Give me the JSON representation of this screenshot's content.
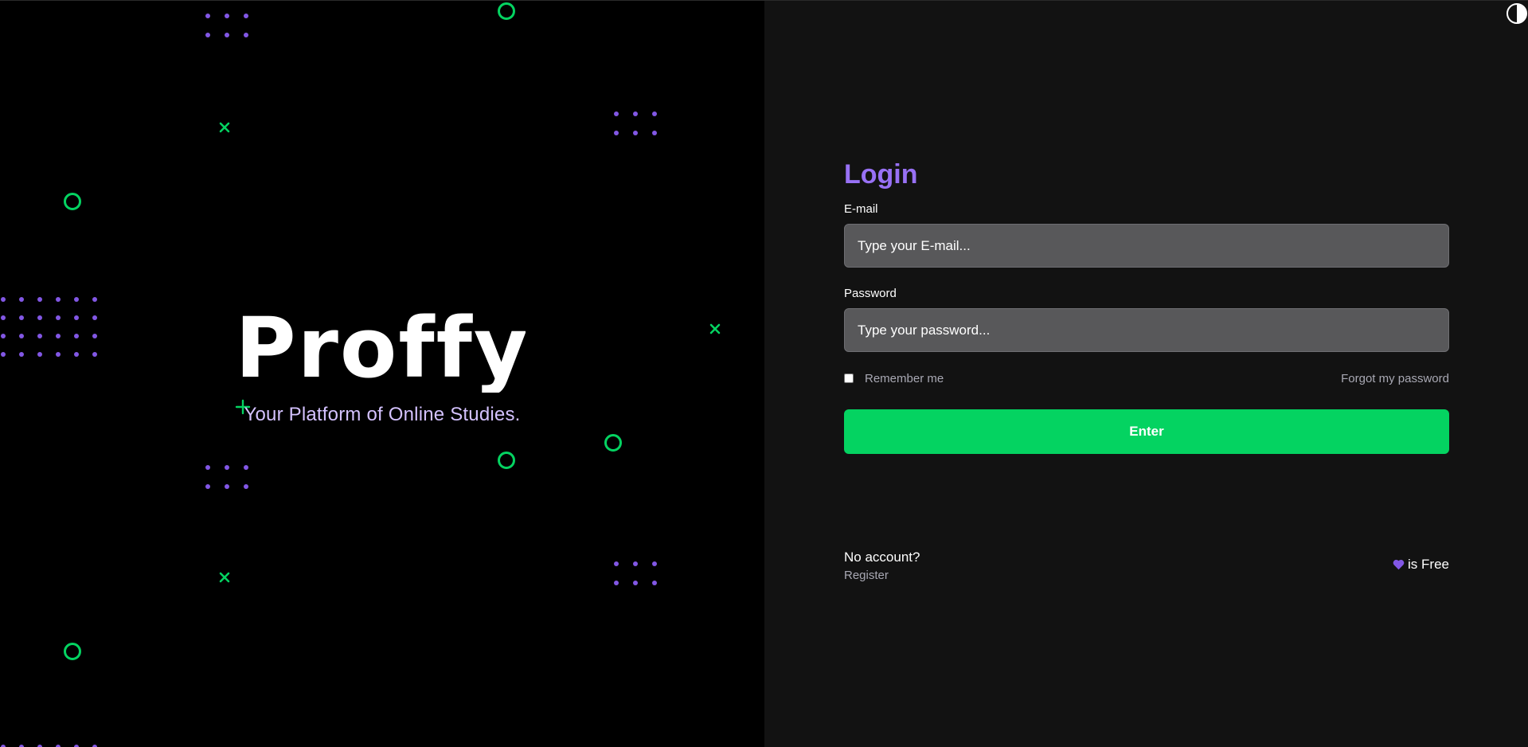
{
  "brand": {
    "name": "Proffy",
    "tagline": "Your Platform of Online Studies."
  },
  "login": {
    "title": "Login",
    "email_label": "E-mail",
    "email_placeholder": "Type your E-mail...",
    "password_label": "Password",
    "password_placeholder": "Type your password...",
    "remember_label": "Remember me",
    "forgot_label": "Forgot my password",
    "submit_label": "Enter"
  },
  "footer": {
    "no_account": "No account?",
    "register_label": "Register",
    "free_label": "is Free"
  },
  "icons": {
    "heart": "heart-icon",
    "theme_toggle": "contrast-icon"
  },
  "colors": {
    "primary": "#8257e5",
    "title_purple": "#9871f5",
    "secondary": "#04d361",
    "left_bg": "#000000",
    "right_bg": "#121212",
    "input_bg": "#58585a"
  }
}
